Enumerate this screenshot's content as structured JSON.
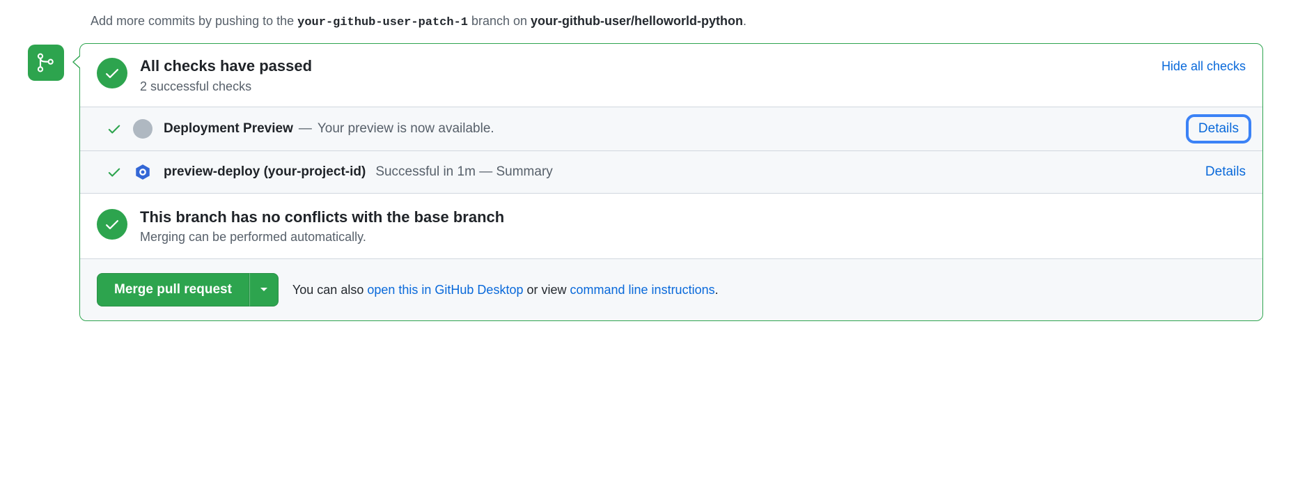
{
  "push_hint": {
    "prefix": "Add more commits by pushing to the ",
    "branch": "your-github-user-patch-1",
    "mid": " branch on ",
    "repo": "your-github-user/helloworld-python",
    "suffix": "."
  },
  "checks_header": {
    "title": "All checks have passed",
    "subtitle": "2 successful checks",
    "hide_label": "Hide all checks"
  },
  "checks": [
    {
      "name": "Deployment Preview",
      "sep": " — ",
      "message": "Your preview is now available.",
      "details_label": "Details",
      "avatar": "grey",
      "highlighted": true
    },
    {
      "name": "preview-deploy (your-project-id)",
      "sep": "",
      "message": "Successful in 1m — Summary",
      "details_label": "Details",
      "avatar": "hex",
      "highlighted": false
    }
  ],
  "conflicts": {
    "title": "This branch has no conflicts with the base branch",
    "subtitle": "Merging can be performed automatically."
  },
  "merge": {
    "button_label": "Merge pull request",
    "hint_prefix": "You can also ",
    "desktop_link": "open this in GitHub Desktop",
    "hint_mid": " or view ",
    "cli_link": "command line instructions",
    "hint_suffix": "."
  }
}
